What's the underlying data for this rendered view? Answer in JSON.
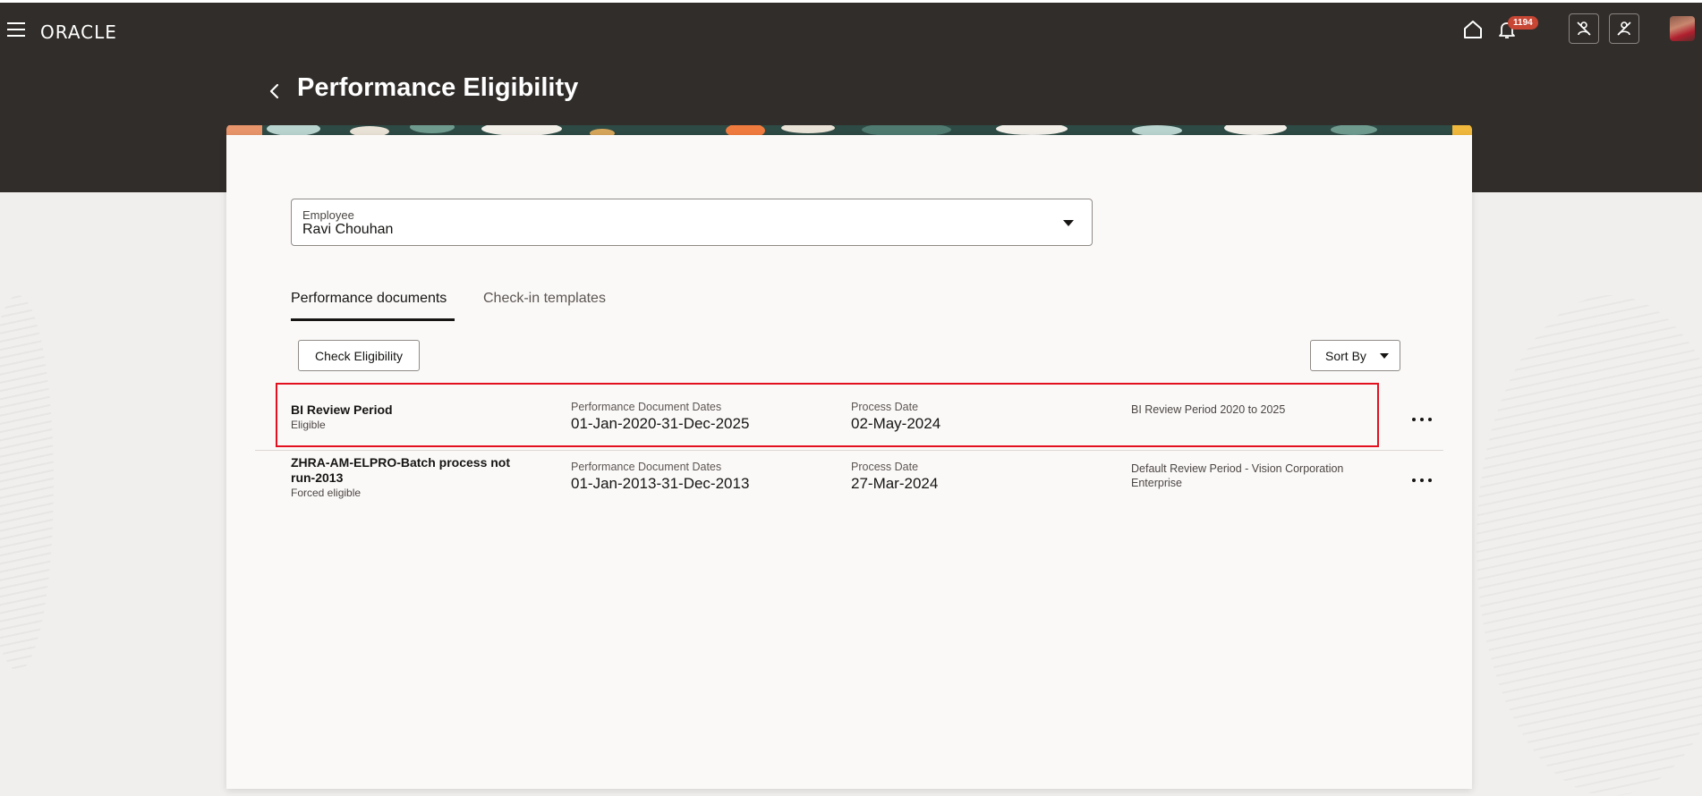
{
  "app": {
    "brand": "ORACLE",
    "notification_count": "1194"
  },
  "page": {
    "title": "Performance Eligibility"
  },
  "employee": {
    "label": "Employee",
    "value": "Ravi Chouhan"
  },
  "tabs": [
    {
      "label": "Performance documents",
      "active": true
    },
    {
      "label": "Check-in templates",
      "active": false
    }
  ],
  "actions": {
    "check_eligibility": "Check Eligibility",
    "sort_by": "Sort By"
  },
  "rows": [
    {
      "name": "BI Review Period",
      "status": "Eligible",
      "dates_label": "Performance Document Dates",
      "dates": "01-Jan-2020-31-Dec-2025",
      "process_label": "Process Date",
      "process_date": "02-May-2024",
      "period": "BI Review Period 2020 to 2025"
    },
    {
      "name": "ZHRA-AM-ELPRO-Batch process not run-2013",
      "status": "Forced eligible",
      "dates_label": "Performance Document Dates",
      "dates": "01-Jan-2013-31-Dec-2013",
      "process_label": "Process Date",
      "process_date": "27-Mar-2024",
      "period": "Default Review Period - Vision Corporation Enterprise"
    }
  ],
  "colors": {
    "header_bg": "#312d2a",
    "highlight": "#e3101f",
    "badge": "#c74634",
    "page_bg": "#f1efed",
    "card_bg": "#fbf9f8"
  },
  "icons": [
    "menu-icon",
    "home-icon",
    "bell-icon",
    "person-assist-icon",
    "person-off-icon",
    "back-arrow-icon",
    "more-options-icon",
    "chevron-down-icon"
  ]
}
